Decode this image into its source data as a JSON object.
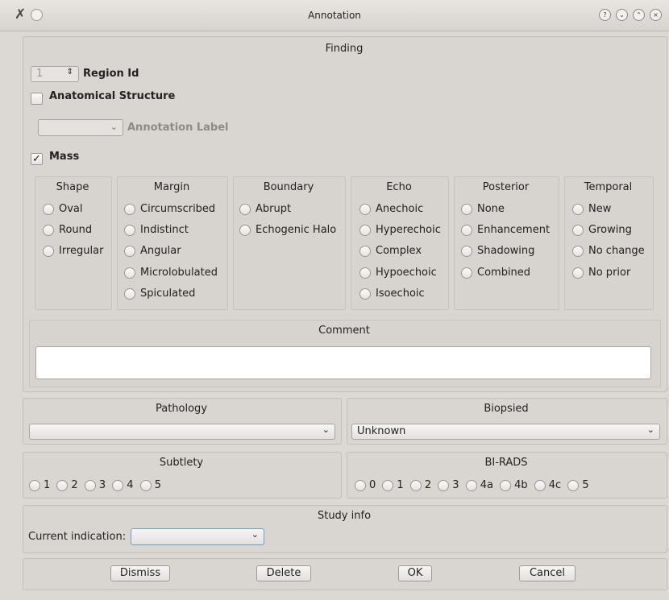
{
  "window": {
    "title": "Annotation"
  },
  "finding": {
    "title": "Finding",
    "region_id_value": "1",
    "region_id_label": "Region Id",
    "anatomical_label": "Anatomical Structure",
    "annotation_label": "Annotation Label",
    "mass_label": "Mass",
    "mass_checkmark": "✓",
    "groups": {
      "shape": {
        "title": "Shape",
        "options": [
          "Oval",
          "Round",
          "Irregular"
        ]
      },
      "margin": {
        "title": "Margin",
        "options": [
          "Circumscribed",
          "Indistinct",
          "Angular",
          "Microlobulated",
          "Spiculated"
        ]
      },
      "boundary": {
        "title": "Boundary",
        "options": [
          "Abrupt",
          "Echogenic Halo"
        ]
      },
      "echo": {
        "title": "Echo",
        "options": [
          "Anechoic",
          "Hyperechoic",
          "Complex",
          "Hypoechoic",
          "Isoechoic"
        ]
      },
      "posterior": {
        "title": "Posterior",
        "options": [
          "None",
          "Enhancement",
          "Shadowing",
          "Combined"
        ]
      },
      "temporal": {
        "title": "Temporal",
        "options": [
          "New",
          "Growing",
          "No change",
          "No prior"
        ]
      }
    },
    "comment": {
      "title": "Comment",
      "value": ""
    }
  },
  "pathology": {
    "title": "Pathology",
    "value": ""
  },
  "biopsied": {
    "title": "Biopsied",
    "value": "Unknown"
  },
  "subtlety": {
    "title": "Subtlety",
    "options": [
      "1",
      "2",
      "3",
      "4",
      "5"
    ]
  },
  "birads": {
    "title": "BI-RADS",
    "options": [
      "0",
      "1",
      "2",
      "3",
      "4a",
      "4b",
      "4c",
      "5"
    ]
  },
  "study_info": {
    "title": "Study info",
    "current_indication_label": "Current indication:",
    "current_indication_value": ""
  },
  "buttons": {
    "dismiss": "Dismiss",
    "delete": "Delete",
    "ok": "OK",
    "cancel": "Cancel"
  },
  "icons": {
    "app": "tools-icon",
    "help": "help-icon",
    "minimize": "minimize-icon",
    "maximize": "maximize-icon",
    "close": "close-icon"
  }
}
